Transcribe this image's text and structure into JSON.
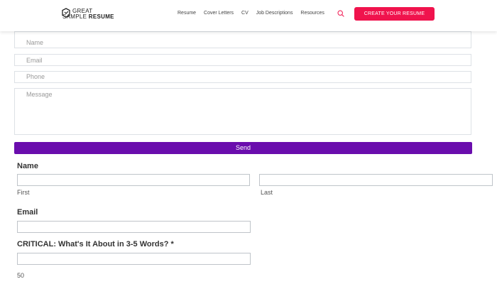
{
  "header": {
    "logo": {
      "line1": "GREAT",
      "line2_a": "SAMPLE",
      "line2_b": "RESUME"
    },
    "nav": [
      "Resume",
      "Cover Letters",
      "CV",
      "Job Descriptions",
      "Resources"
    ],
    "cta": "CREATE YOUR RESUME",
    "colors": {
      "cta": "#f0134d",
      "search_icon": "#f0134d"
    }
  },
  "contact_form": {
    "name_placeholder": "Name",
    "email_placeholder": "Email",
    "phone_placeholder": "Phone",
    "message_placeholder": "Message",
    "send_label": "Send",
    "send_color": "#6a0dad"
  },
  "submit_form": {
    "name_label": "Name",
    "first_sublabel": "First",
    "last_sublabel": "Last",
    "email_label": "Email",
    "critical_label": "CRITICAL: What's It About in 3-5 Words? *",
    "char_count": "50"
  }
}
